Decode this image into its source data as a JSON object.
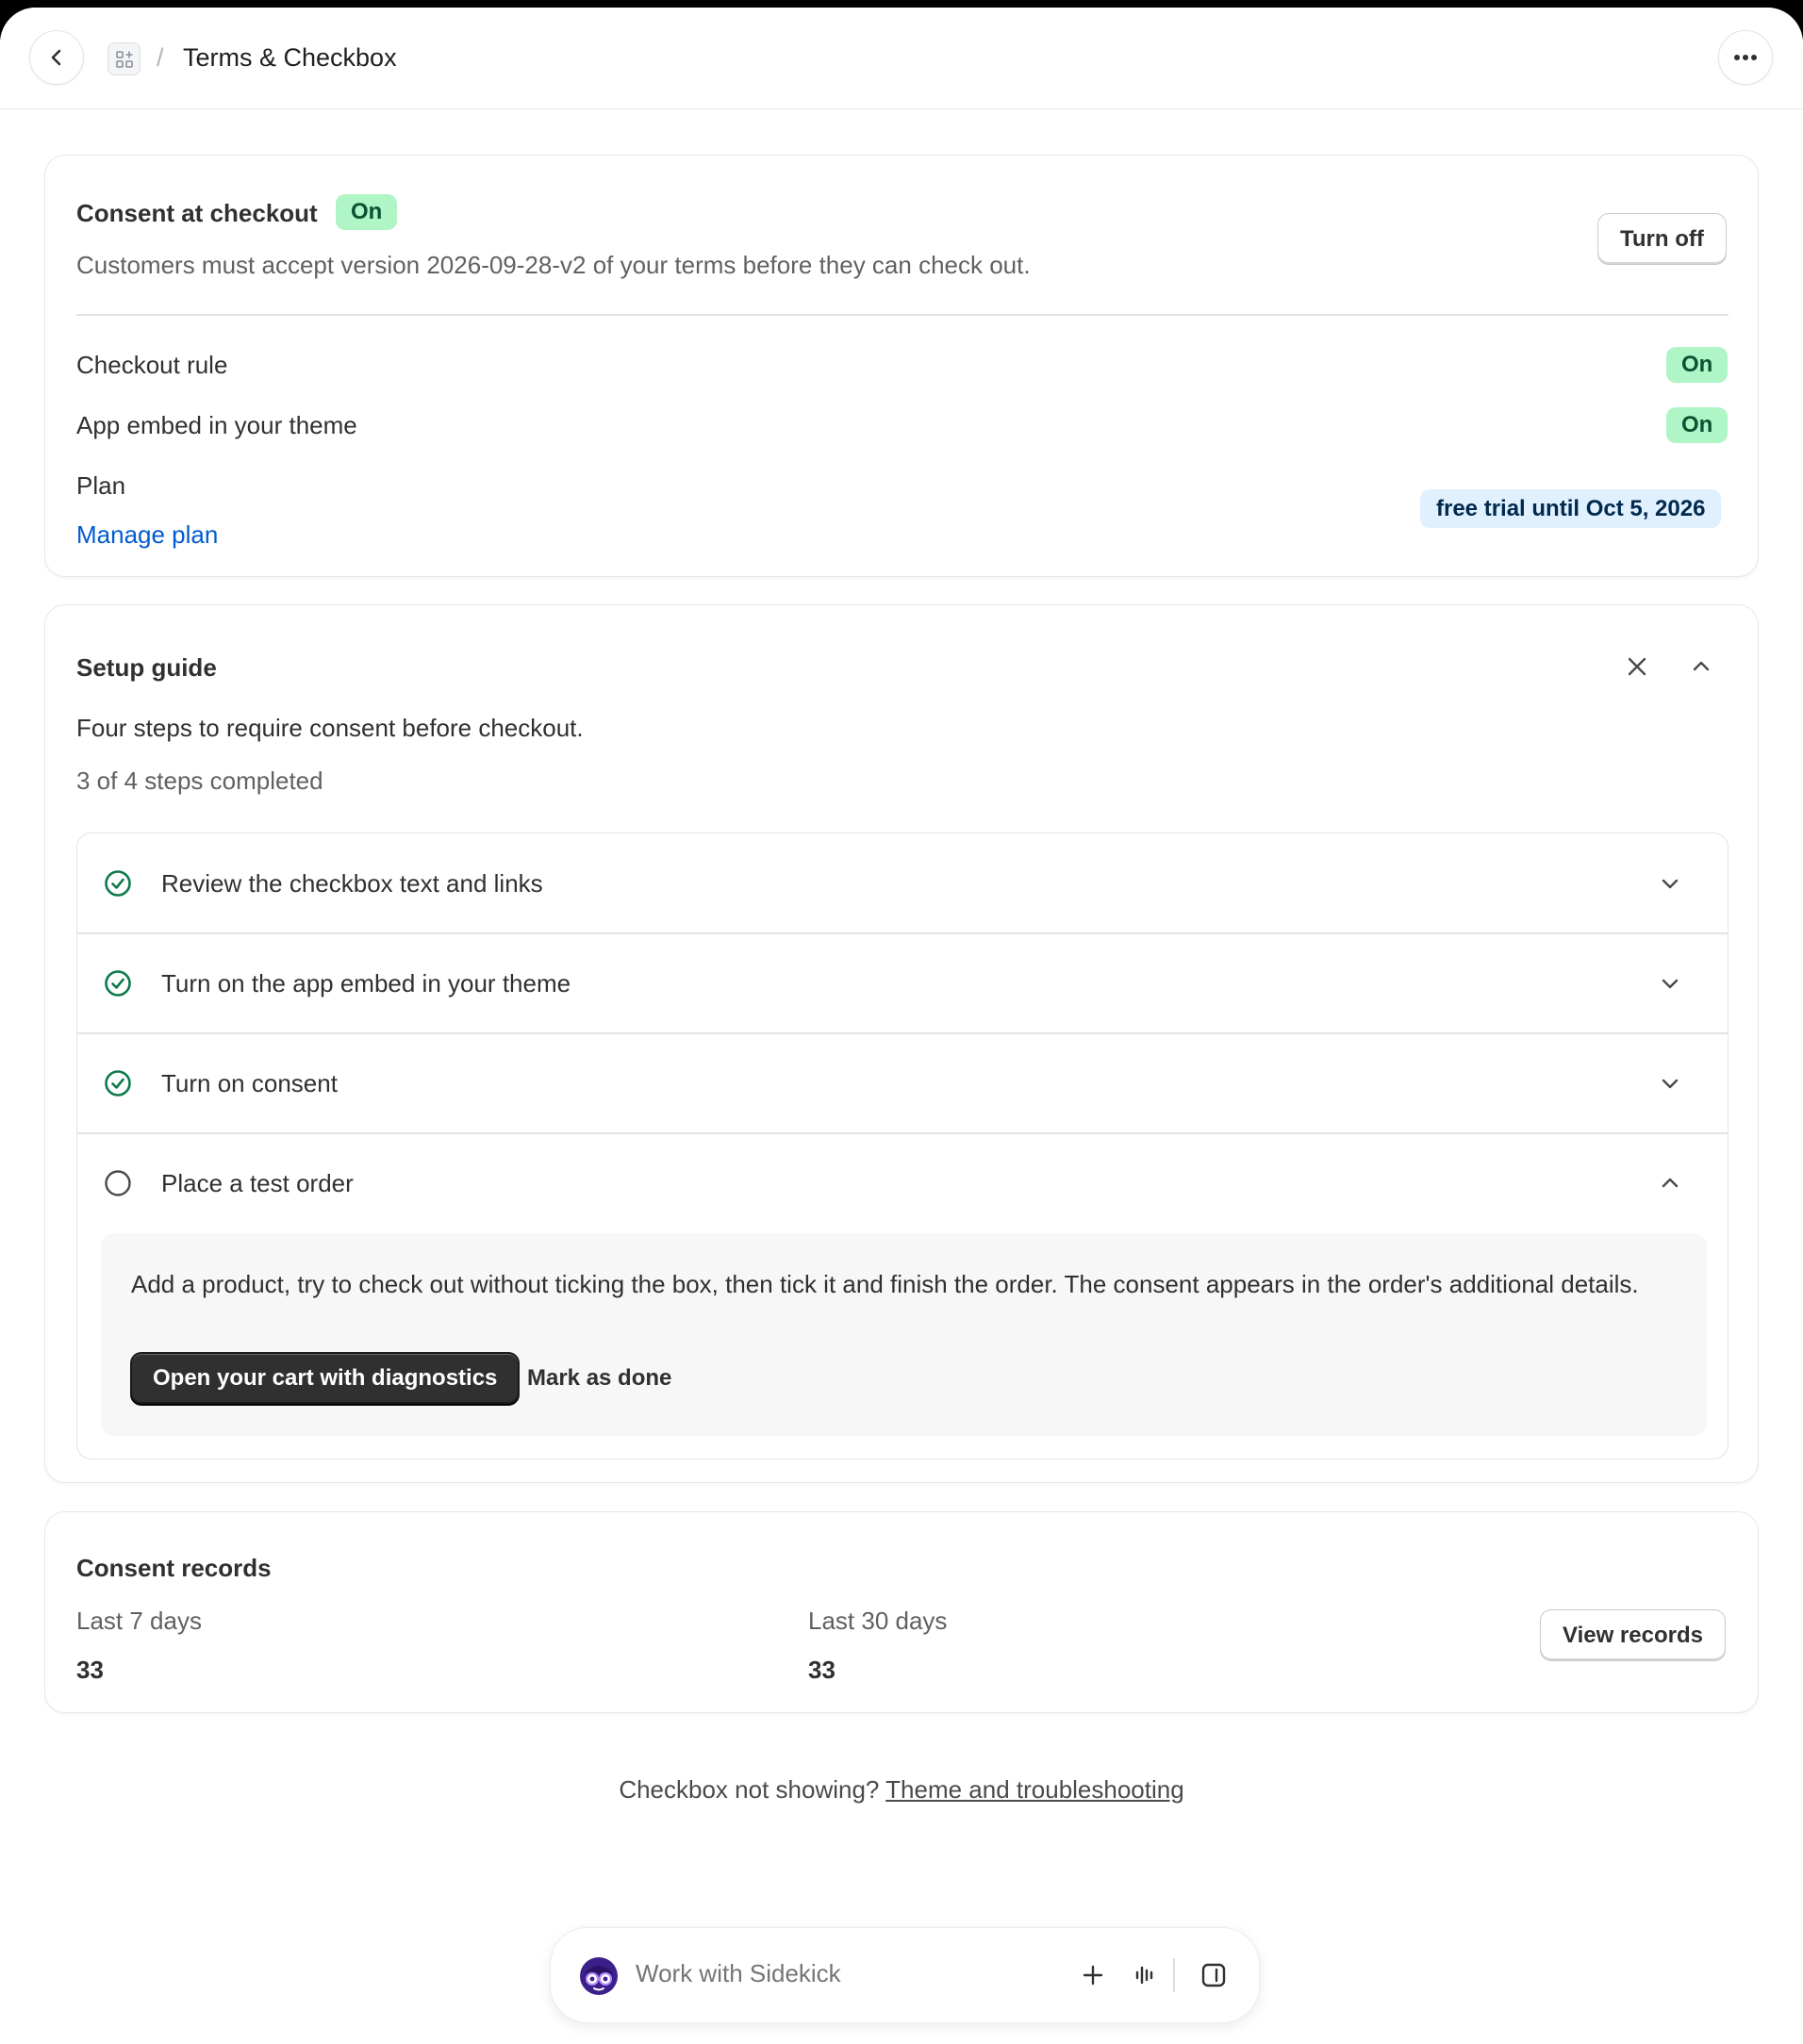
{
  "header": {
    "title": "Terms & Checkbox",
    "separator": "/"
  },
  "consent_card": {
    "title": "Consent at checkout",
    "status": "On",
    "description": "Customers must accept version 2026-09-28-v2 of your terms before they can check out.",
    "turn_off_label": "Turn off",
    "rows": [
      {
        "label": "Checkout rule",
        "status": "On"
      },
      {
        "label": "App embed in your theme",
        "status": "On"
      }
    ],
    "plan_label": "Plan",
    "plan_badge": "free trial until Oct 5, 2026",
    "manage_plan_label": "Manage plan"
  },
  "setup_guide": {
    "title": "Setup guide",
    "subtitle": "Four steps to require consent before checkout.",
    "progress": "3 of 4 steps completed",
    "steps": [
      {
        "label": "Review the checkbox text and links",
        "done": true
      },
      {
        "label": "Turn on the app embed in your theme",
        "done": true
      },
      {
        "label": "Turn on consent",
        "done": true
      },
      {
        "label": "Place a test order",
        "done": false
      }
    ],
    "expanded_step": {
      "text": "Add a product, try to check out without ticking the box, then tick it and finish the order. The consent appears in the order's additional details.",
      "primary_label": "Open your cart with diagnostics",
      "secondary_label": "Mark as done"
    }
  },
  "records": {
    "title": "Consent records",
    "stats": [
      {
        "label": "Last 7 days",
        "value": "33"
      },
      {
        "label": "Last 30 days",
        "value": "33"
      }
    ],
    "view_label": "View records"
  },
  "footer": {
    "question": "Checkbox not showing?",
    "link": "Theme and troubleshooting"
  },
  "sidekick": {
    "placeholder": "Work with Sidekick"
  },
  "colors": {
    "success_badge_bg": "#aff5c6",
    "success_icon": "#0c7a4a",
    "info_badge_bg": "#e0f0ff",
    "link": "#005bd3",
    "primary_button": "#303030"
  }
}
